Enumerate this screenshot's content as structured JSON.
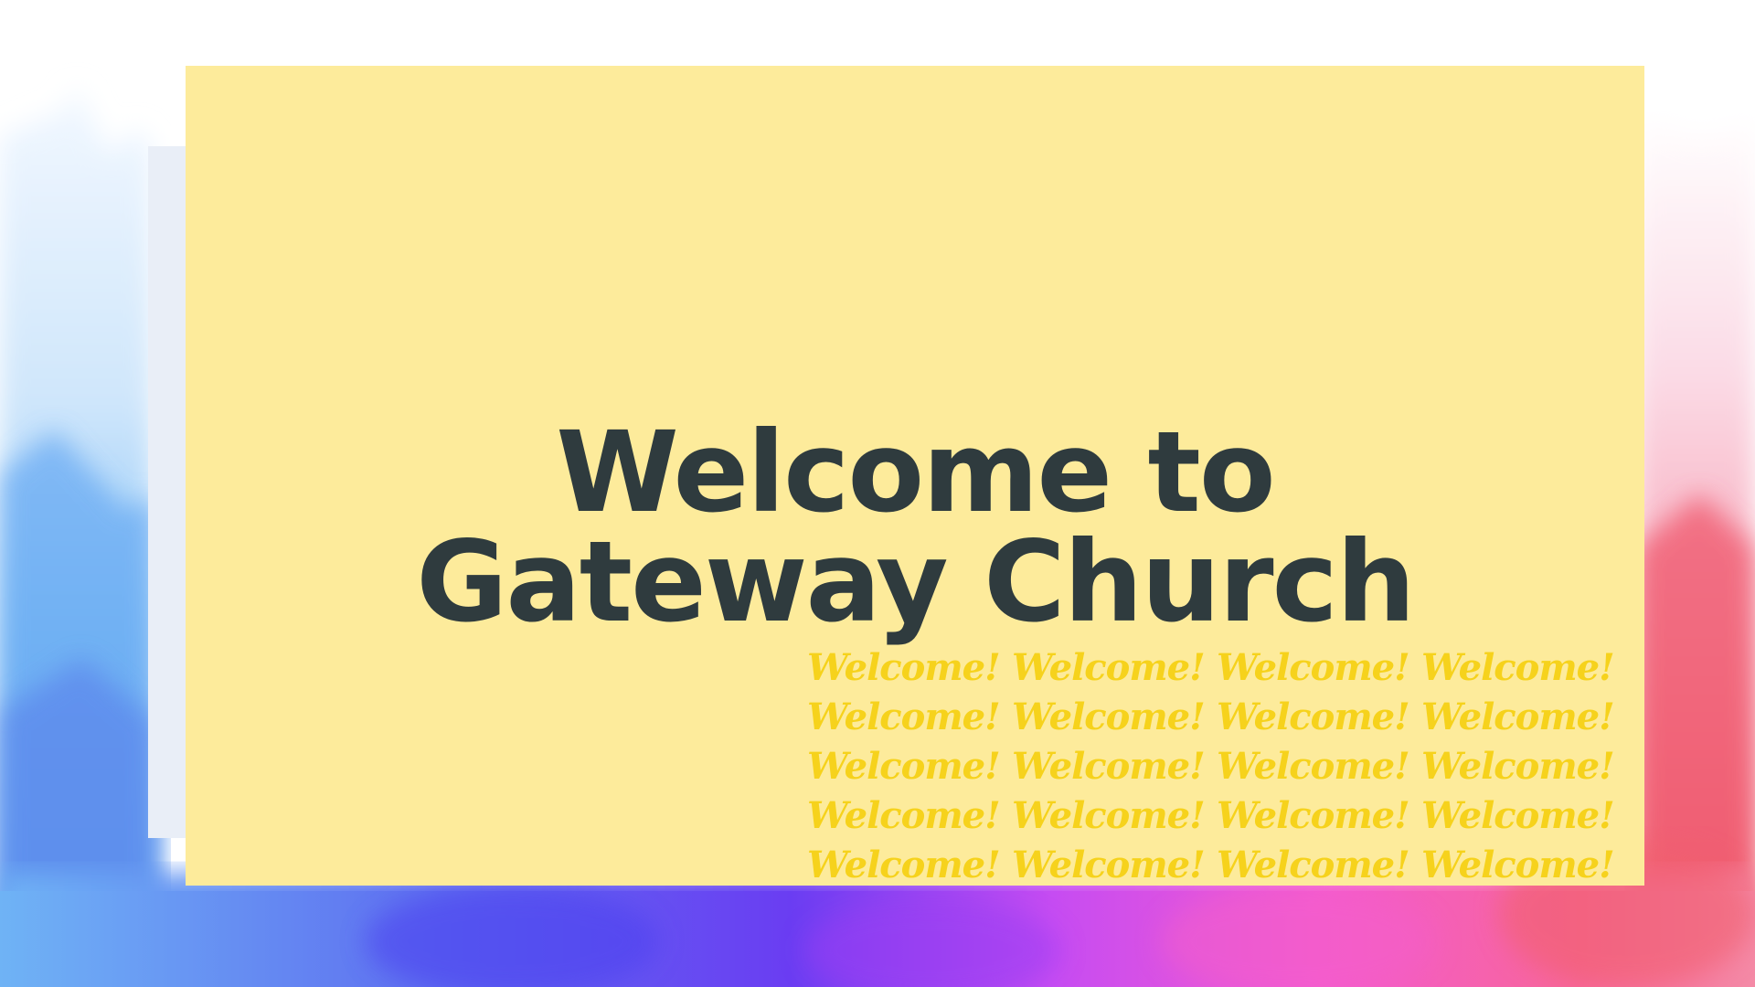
{
  "slide": {
    "title_line1": "Welcome to",
    "title_line2": "Gateway Church",
    "repeat_word": "Welcome!",
    "repeat_rows": 5,
    "repeat_cols": 4
  },
  "colors": {
    "card_background": "#fdeb9b",
    "title_text": "#2f3b3e",
    "repeat_text": "#f6d21c",
    "backdrop": "watercolor gradient blue-purple-pink-red"
  }
}
